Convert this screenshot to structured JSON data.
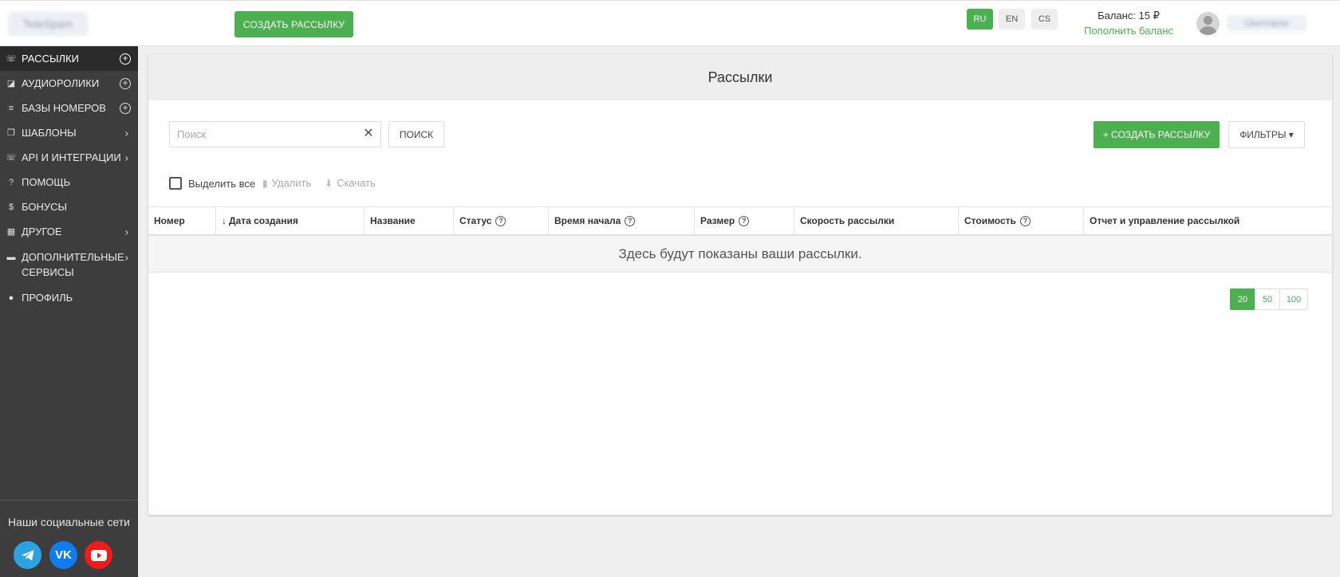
{
  "header": {
    "logo_text": "TeleSpam",
    "create_button": "СОЗДАТЬ РАССЫЛКУ",
    "languages": [
      {
        "code": "RU",
        "active": true
      },
      {
        "code": "EN",
        "active": false
      },
      {
        "code": "CS",
        "active": false
      }
    ],
    "balance": "Баланс: 15 ₽",
    "topup": "Пополнить баланс",
    "username": "Username"
  },
  "sidebar": {
    "items": [
      {
        "label": "РАССЫЛКИ",
        "icon": "phone-icon",
        "active": true,
        "action": "plus"
      },
      {
        "label": "АУДИОРОЛИКИ",
        "icon": "audio-icon",
        "active": false,
        "action": "plus"
      },
      {
        "label": "БАЗЫ НОМЕРОВ",
        "icon": "database-icon",
        "active": false,
        "action": "plus"
      },
      {
        "label": "ШАБЛОНЫ",
        "icon": "copy-icon",
        "active": false,
        "action": "chevron"
      },
      {
        "label": "API И ИНТЕГРАЦИИ",
        "icon": "phone-forward-icon",
        "active": false,
        "action": "chevron"
      },
      {
        "label": "ПОМОЩЬ",
        "icon": "question-icon",
        "active": false,
        "action": "none"
      },
      {
        "label": "БОНУСЫ",
        "icon": "dollar-icon",
        "active": false,
        "action": "none"
      },
      {
        "label": "ДРУГОЕ",
        "icon": "grid-icon",
        "active": false,
        "action": "chevron"
      },
      {
        "label": "ДОПОЛНИТЕЛЬНЫЕ СЕРВИСЫ",
        "icon": "services-icon",
        "active": false,
        "action": "chevron"
      },
      {
        "label": "ПРОФИЛЬ",
        "icon": "user-icon",
        "active": false,
        "action": "none"
      }
    ],
    "social_title": "Наши социальные сети",
    "social": [
      {
        "name": "telegram",
        "color": "#2aa3e0"
      },
      {
        "name": "vk",
        "color": "#0f7cf2"
      },
      {
        "name": "youtube",
        "color": "#ef1c1c"
      }
    ]
  },
  "main": {
    "title": "Рассылки",
    "search_placeholder": "Поиск",
    "search_button": "ПОИСК",
    "create_button": "+ СОЗДАТЬ РАССЫЛКУ",
    "filters_button": "ФИЛЬТРЫ ▾",
    "select_all": "Выделить все",
    "delete": "Удалить",
    "download": "Скачать",
    "columns": [
      {
        "label": "Номер",
        "help": false,
        "sort": false
      },
      {
        "label": "Дата создания",
        "help": false,
        "sort": true
      },
      {
        "label": "Название",
        "help": false,
        "sort": false
      },
      {
        "label": "Статус",
        "help": true,
        "sort": false
      },
      {
        "label": "Время начала",
        "help": true,
        "sort": false
      },
      {
        "label": "Размер",
        "help": true,
        "sort": false
      },
      {
        "label": "Скорость рассылки",
        "help": false,
        "sort": false
      },
      {
        "label": "Стоимость",
        "help": true,
        "sort": false
      },
      {
        "label": "Отчет и управление рассылкой",
        "help": false,
        "sort": false
      }
    ],
    "empty_text": "Здесь будут показаны ваши рассылки.",
    "page_sizes": [
      {
        "label": "20",
        "active": true
      },
      {
        "label": "50",
        "active": false
      },
      {
        "label": "100",
        "active": false
      }
    ]
  },
  "colors": {
    "accent": "#4caf50",
    "sidebar_bg": "#3d3d3d",
    "sidebar_active": "#2b2b2b"
  }
}
